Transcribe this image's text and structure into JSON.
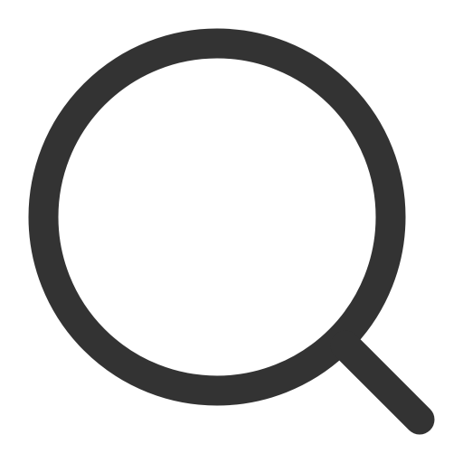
{
  "icon": {
    "name": "search-icon",
    "stroke_color": "#333333",
    "background_color": "#ffffff"
  }
}
